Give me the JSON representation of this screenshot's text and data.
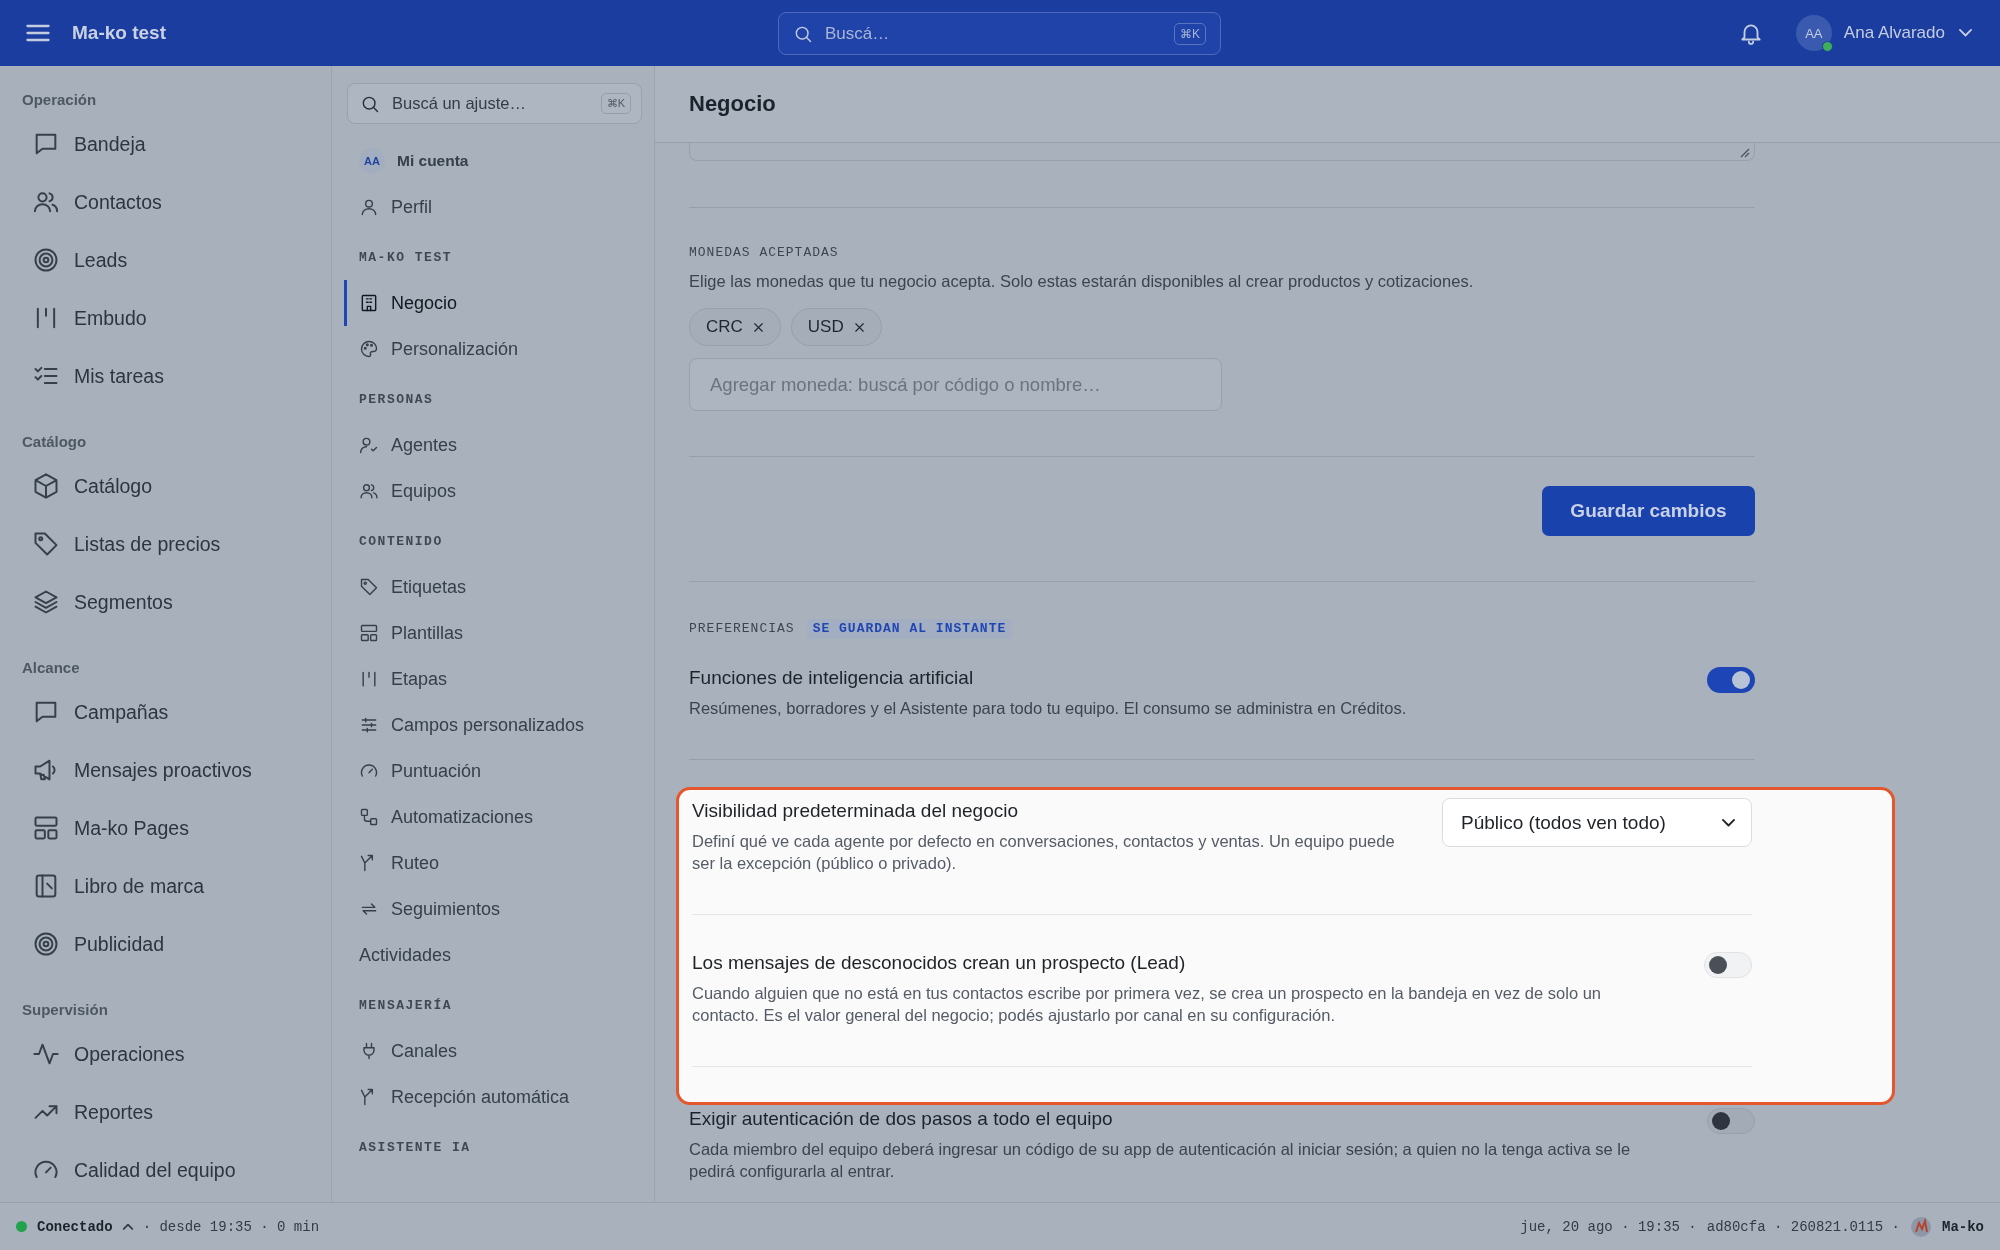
{
  "app": {
    "title": "Ma-ko test"
  },
  "search": {
    "placeholder": "Buscá…",
    "shortcut": "⌘K"
  },
  "user": {
    "initials": "AA",
    "name": "Ana Alvarado",
    "online": true
  },
  "nav": [
    {
      "heading": "Operación",
      "items": [
        {
          "label": "Bandeja",
          "selected": false
        },
        {
          "label": "Contactos",
          "selected": false
        },
        {
          "label": "Leads",
          "selected": false
        },
        {
          "label": "Embudo",
          "selected": false
        },
        {
          "label": "Mis tareas",
          "selected": false
        }
      ]
    },
    {
      "heading": "Catálogo",
      "items": [
        {
          "label": "Catálogo",
          "selected": false
        },
        {
          "label": "Listas de precios",
          "selected": false
        },
        {
          "label": "Segmentos",
          "selected": false
        }
      ]
    },
    {
      "heading": "Alcance",
      "items": [
        {
          "label": "Campañas",
          "selected": false
        },
        {
          "label": "Mensajes proactivos",
          "selected": false
        },
        {
          "label": "Ma-ko Pages",
          "selected": false
        },
        {
          "label": "Libro de marca",
          "selected": false
        },
        {
          "label": "Publicidad",
          "selected": false
        }
      ]
    },
    {
      "heading": "Supervisión",
      "items": [
        {
          "label": "Operaciones",
          "selected": false
        },
        {
          "label": "Reportes",
          "selected": false
        },
        {
          "label": "Calidad del equipo",
          "selected": false
        }
      ]
    }
  ],
  "settings_nav": {
    "search": {
      "placeholder": "Buscá un ajuste…",
      "shortcut": "⌘K"
    },
    "groups": [
      {
        "kind": "account",
        "avatar": "AA",
        "heading": "Mi cuenta",
        "items": [
          {
            "label": "Perfil",
            "selected": false
          }
        ]
      },
      {
        "kind": "section",
        "heading": "MA-KO TEST",
        "items": [
          {
            "label": "Negocio",
            "selected": true
          },
          {
            "label": "Personalización",
            "selected": false
          }
        ]
      },
      {
        "kind": "section",
        "heading": "PERSONAS",
        "items": [
          {
            "label": "Agentes",
            "selected": false
          },
          {
            "label": "Equipos",
            "selected": false
          }
        ]
      },
      {
        "kind": "section",
        "heading": "CONTENIDO",
        "items": [
          {
            "label": "Etiquetas",
            "selected": false
          },
          {
            "label": "Plantillas",
            "selected": false
          },
          {
            "label": "Etapas",
            "selected": false
          },
          {
            "label": "Campos personalizados",
            "selected": false
          },
          {
            "label": "Puntuación",
            "selected": false
          },
          {
            "label": "Automatizaciones",
            "selected": false
          },
          {
            "label": "Ruteo",
            "selected": false
          },
          {
            "label": "Seguimientos",
            "selected": false
          },
          {
            "label": "Actividades",
            "selected": false
          }
        ]
      },
      {
        "kind": "section",
        "heading": "MENSAJERÍA",
        "items": [
          {
            "label": "Canales",
            "selected": false
          },
          {
            "label": "Recepción automática",
            "selected": false
          }
        ]
      },
      {
        "kind": "section",
        "heading": "ASISTENTE IA"
      }
    ]
  },
  "page": {
    "title": "Negocio",
    "currencies": {
      "heading": "MONEDAS ACEPTADAS",
      "description": "Elige las monedas que tu negocio acepta. Solo estas estarán disponibles al crear productos y cotizaciones.",
      "chips": [
        {
          "label": "CRC"
        },
        {
          "label": "USD"
        }
      ],
      "placeholder": "Agregar moneda: buscá por código o nombre…"
    },
    "save_button": "Guardar cambios",
    "preferences": {
      "heading": "PREFERENCIAS",
      "badge": "SE GUARDAN AL INSTANTE",
      "settings": [
        {
          "kind": "toggle",
          "title": "Funciones de inteligencia artificial",
          "description": "Resúmenes, borradores y el Asistente para todo tu equipo. El consumo se administra en Créditos.",
          "on": true,
          "highlighted": false
        },
        {
          "kind": "select",
          "title": "Visibilidad predeterminada del negocio",
          "description": "Definí qué ve cada agente por defecto en conversaciones, contactos y ventas. Un equipo puede ser la excepción (público o privado).",
          "value": "Público (todos ven todo)",
          "highlighted": true
        },
        {
          "kind": "toggle",
          "title": "Los mensajes de desconocidos crean un prospecto (Lead)",
          "description": "Cuando alguien que no está en tus contactos escribe por primera vez, se crea un prospecto en la bandeja en vez de solo un contacto. Es el valor general del negocio; podés ajustarlo por canal en su configuración.",
          "on": false,
          "highlighted": true
        },
        {
          "kind": "toggle",
          "title": "Exigir autenticación de dos pasos a todo el equipo",
          "description": "Cada miembro del equipo deberá ingresar un código de su app de autenticación al iniciar sesión; a quien no la tenga activa se le pedirá configurarla al entrar.",
          "on": false,
          "highlighted": false
        }
      ]
    }
  },
  "status_bar": {
    "connection": "Conectado",
    "connected": true,
    "since": "· desde 19:35 · 0 min",
    "date": "jue, 20 ago · 19:35 ·",
    "build": "ad80cfa · 260821.0115 ·",
    "brand": "Ma-ko"
  }
}
